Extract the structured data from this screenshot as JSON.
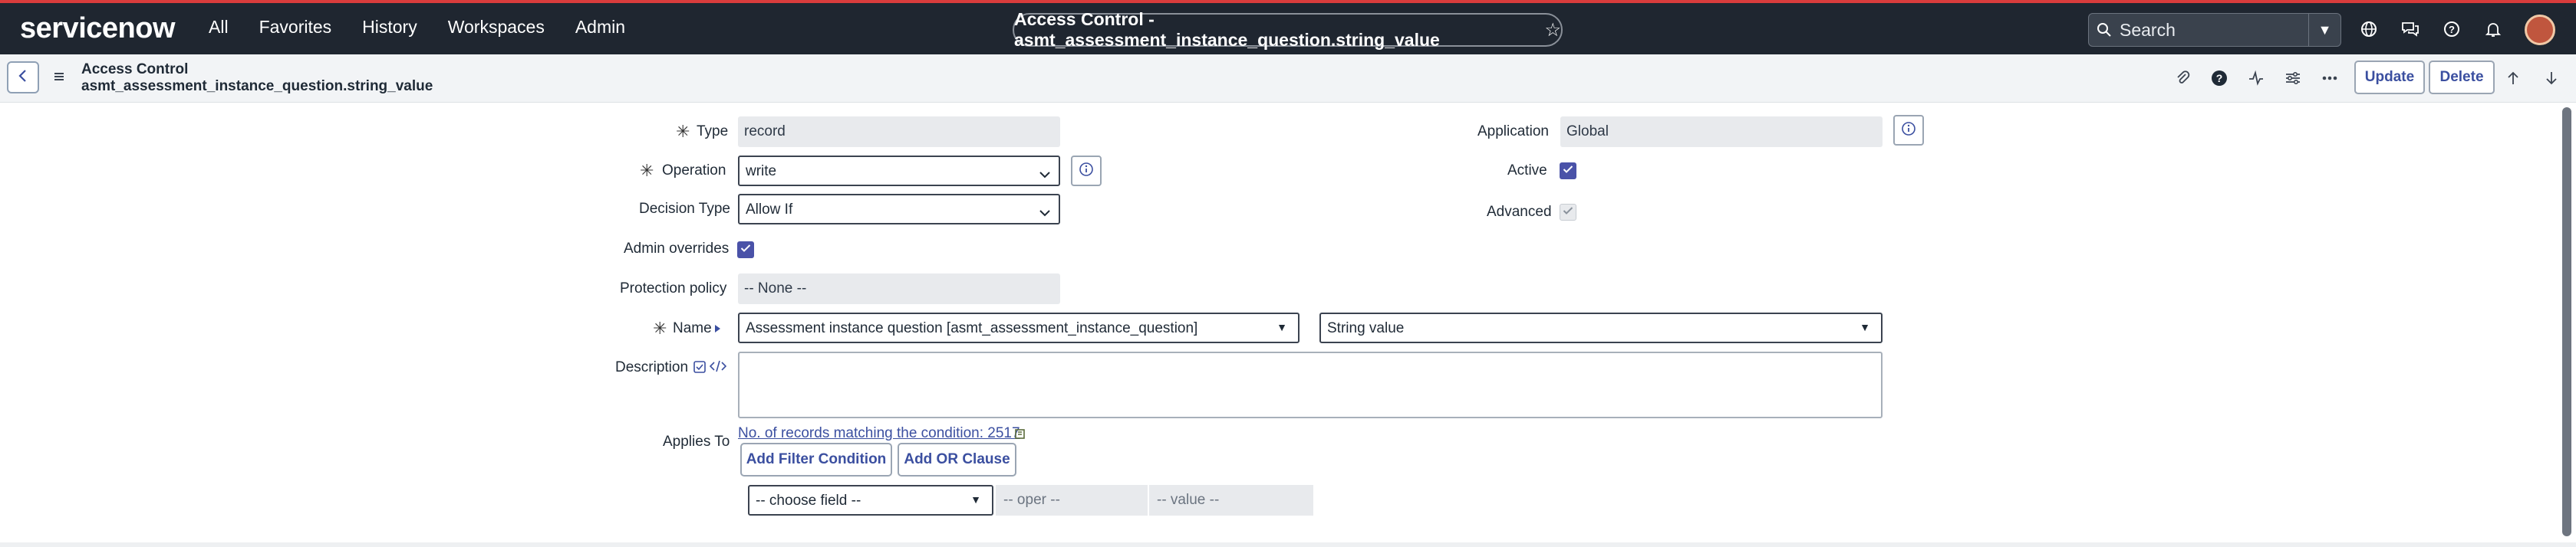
{
  "topnav": {
    "brand": "servicenow",
    "links": [
      "All",
      "Favorites",
      "History",
      "Workspaces",
      "Admin"
    ],
    "record_title": "Access Control - asmt_assessment_instance_question.string_value",
    "search_placeholder": "Search"
  },
  "header": {
    "title": "Access Control",
    "subtitle": "asmt_assessment_instance_question.string_value",
    "update_label": "Update",
    "delete_label": "Delete"
  },
  "form": {
    "type_label": "Type",
    "type_value": "record",
    "operation_label": "Operation",
    "operation_value": "write",
    "decision_type_label": "Decision Type",
    "decision_type_value": "Allow If",
    "admin_overrides_label": "Admin overrides",
    "admin_overrides_checked": true,
    "protection_policy_label": "Protection policy",
    "protection_policy_value": "-- None --",
    "name_label": "Name",
    "name_table_value": "Assessment instance question [asmt_assessment_instance_question]",
    "name_field_value": "String value",
    "description_label": "Description",
    "applies_to_label": "Applies To",
    "records_link": "No. of records matching the condition: 2517",
    "add_filter_label": "Add Filter Condition",
    "add_or_label": "Add OR Clause",
    "choose_field": "-- choose field --",
    "oper": "-- oper --",
    "value": "-- value --",
    "application_label": "Application",
    "application_value": "Global",
    "active_label": "Active",
    "active_checked": true,
    "advanced_label": "Advanced",
    "advanced_checked": true
  },
  "colors": {
    "nav_bg": "#1f2630",
    "accent": "#4a52a8",
    "link": "#3b4fa0",
    "brand_green": "#62d84e"
  }
}
